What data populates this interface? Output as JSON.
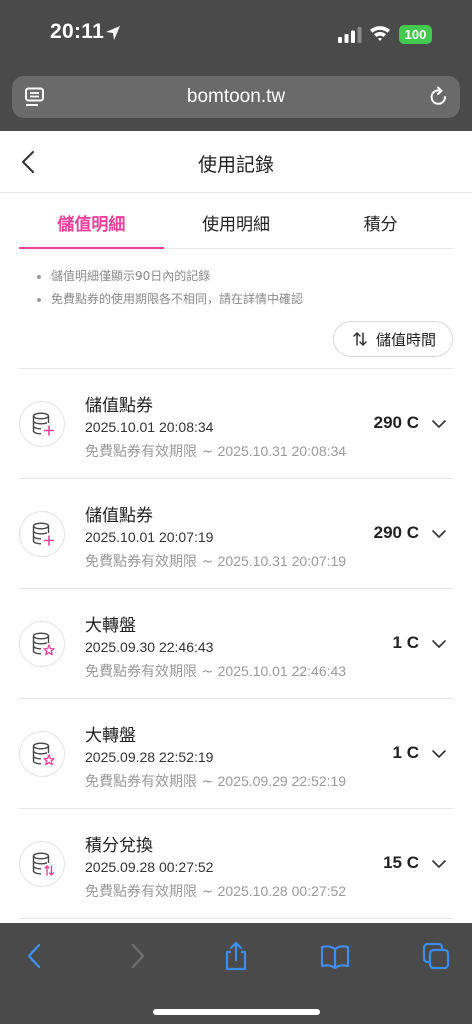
{
  "status_bar": {
    "time": "20:11",
    "battery": "100"
  },
  "browser": {
    "url": "bomtoon.tw"
  },
  "header": {
    "title": "使用記錄"
  },
  "tabs": [
    {
      "label": "儲值明細",
      "active": true
    },
    {
      "label": "使用明細",
      "active": false
    },
    {
      "label": "積分",
      "active": false
    }
  ],
  "notes": [
    "儲值明細僅顯示90日內的記錄",
    "免費點券的使用期限各不相同，請在詳情中確認"
  ],
  "sort": {
    "label": "儲值時間"
  },
  "expiry_label": "免費點券有效期限 ~ ",
  "records": [
    {
      "type": "儲值點券",
      "date": "2025.10.01 20:08:34",
      "expiry": "2025.10.31 20:08:34",
      "amount": "290 C",
      "icon": "coin-plus-icon"
    },
    {
      "type": "儲值點券",
      "date": "2025.10.01 20:07:19",
      "expiry": "2025.10.31 20:07:19",
      "amount": "290 C",
      "icon": "coin-plus-icon"
    },
    {
      "type": "大轉盤",
      "date": "2025.09.30 22:46:43",
      "expiry": "2025.10.01 22:46:43",
      "amount": "1 C",
      "icon": "coin-star-icon"
    },
    {
      "type": "大轉盤",
      "date": "2025.09.28 22:52:19",
      "expiry": "2025.09.29 22:52:19",
      "amount": "1 C",
      "icon": "coin-star-icon"
    },
    {
      "type": "積分兌換",
      "date": "2025.09.28 00:27:52",
      "expiry": "2025.10.28 00:27:52",
      "amount": "15 C",
      "icon": "coin-exchange-icon"
    }
  ],
  "colors": {
    "accent": "#f0419a",
    "browser_chrome": "#4a4a4a",
    "battery": "#43c94d",
    "toolbar_blue": "#3d8ef0"
  }
}
